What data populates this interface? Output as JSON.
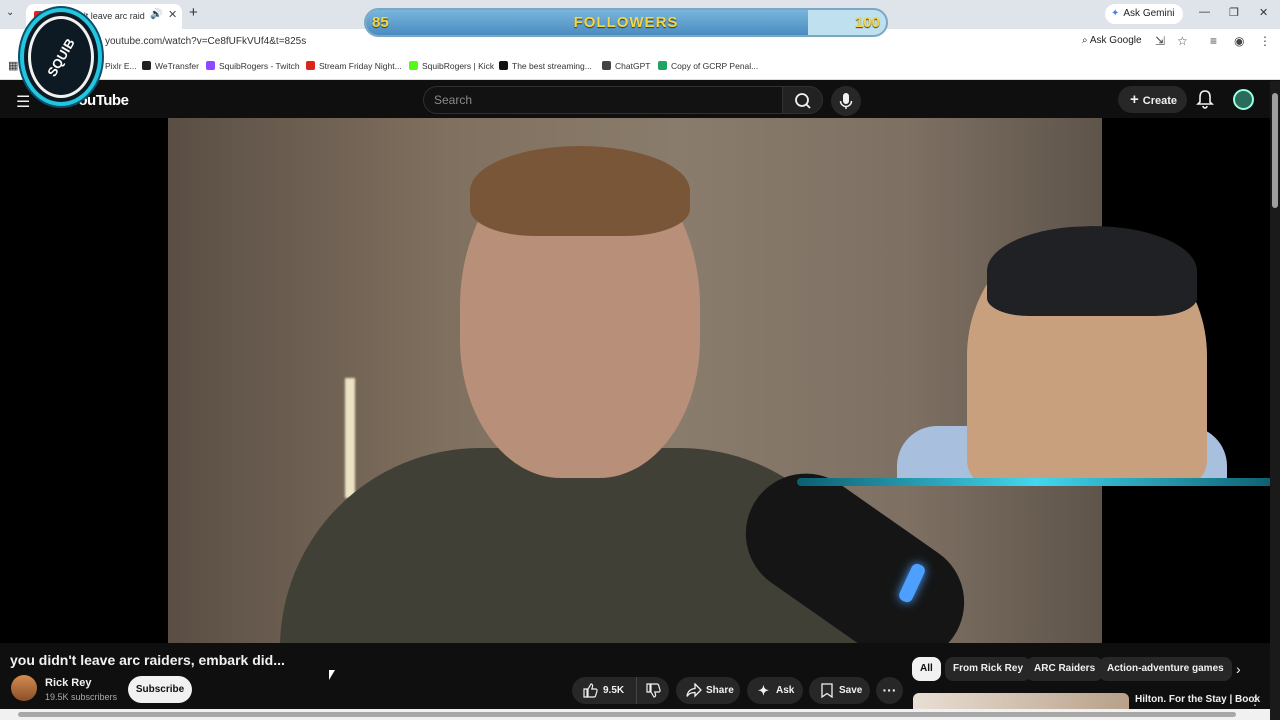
{
  "browser": {
    "tab_title": "you didn't leave arc raiders",
    "url": "youtube.com/watch?v=Ce8fUFkVUf4&t=825s",
    "ask_gemini": "Ask Gemini",
    "ask_google": "Ask Google",
    "bookmarks": [
      {
        "label": "Pixlr E...",
        "color": "#2bb8a0"
      },
      {
        "label": "WeTransfer",
        "color": "#222222"
      },
      {
        "label": "SquibRogers - Twitch",
        "color": "#9146ff"
      },
      {
        "label": "Stream Friday Night...",
        "color": "#d9251d"
      },
      {
        "label": "SquibRogers | Kick",
        "color": "#53fc18"
      },
      {
        "label": "The best streaming...",
        "color": "#111111"
      },
      {
        "label": "ChatGPT",
        "color": "#444444"
      },
      {
        "label": "Copy of GCRP Penal...",
        "color": "#1fa463"
      }
    ]
  },
  "overlay": {
    "followers_current": "85",
    "followers_label": "FOLLOWERS",
    "followers_goal": "100",
    "progress_fraction": 0.85,
    "logo_text": "SQUIB"
  },
  "youtube": {
    "logo": "YouTube",
    "search_placeholder": "Search",
    "create_label": "Create",
    "video_title": "you didn't leave arc raiders, embark did...",
    "channel_name": "Rick Rey",
    "channel_subs": "19.5K subscribers",
    "subscribe_label": "Subscribe",
    "likes": "9.5K",
    "share_label": "Share",
    "ask_label": "Ask",
    "save_label": "Save",
    "chips": [
      {
        "label": "All",
        "active": true
      },
      {
        "label": "From Rick Rey",
        "active": false
      },
      {
        "label": "ARC Raiders",
        "active": false
      },
      {
        "label": "Action-adventure games",
        "active": false
      }
    ],
    "rec_title": "Hilton. For the Stay | Book"
  }
}
